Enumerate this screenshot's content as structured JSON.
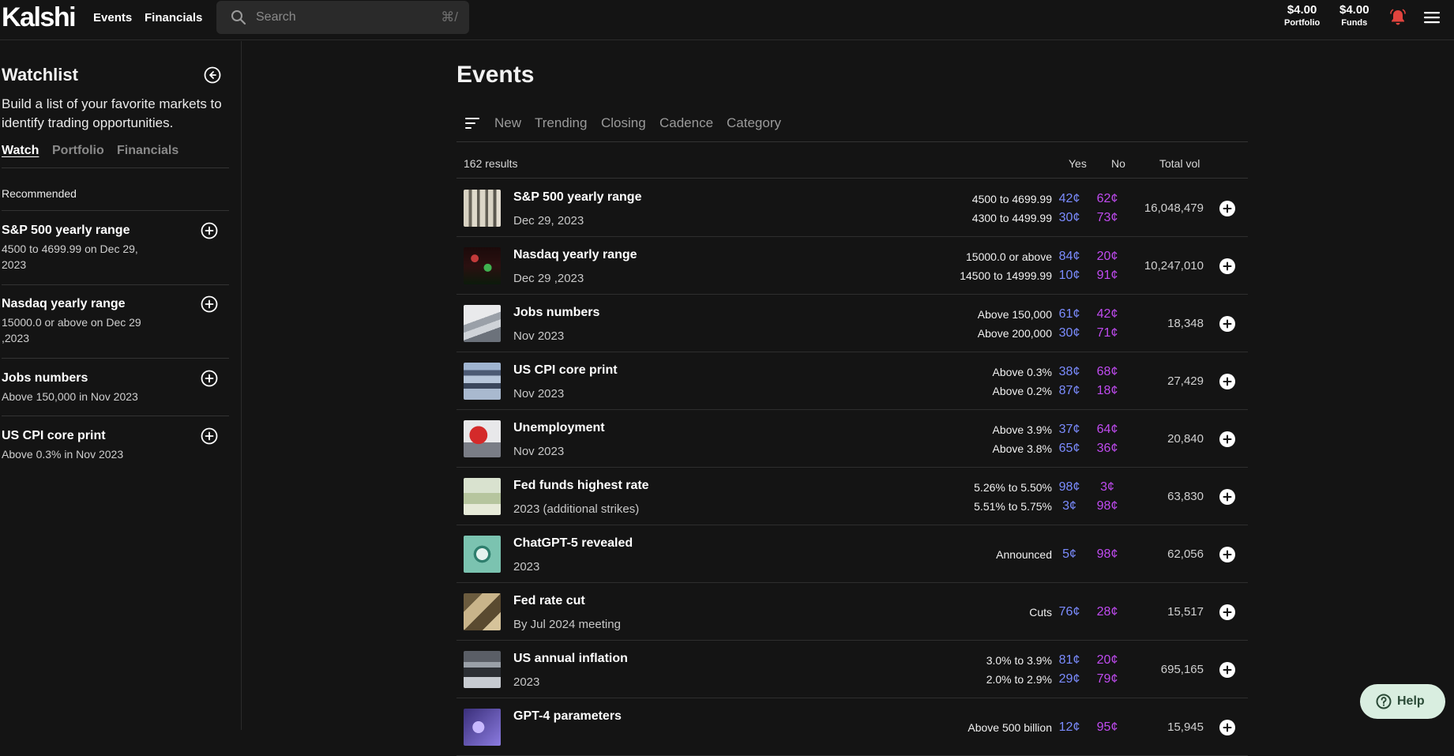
{
  "header": {
    "logo": "Kalshi",
    "nav": [
      {
        "label": "Events"
      },
      {
        "label": "Financials"
      }
    ],
    "search": {
      "placeholder": "Search",
      "shortcut": "⌘/"
    },
    "portfolio": {
      "amount": "$4.00",
      "label": "Portfolio"
    },
    "funds": {
      "amount": "$4.00",
      "label": "Funds"
    },
    "icons": [
      "search-icon",
      "bell-icon",
      "menu-icon"
    ],
    "bell_color": "#e0443e"
  },
  "watchlist": {
    "title": "Watchlist",
    "description": "Build a list of your favorite markets to identify trading opportunities.",
    "tabs": [
      {
        "label": "Watch"
      },
      {
        "label": "Portfolio"
      },
      {
        "label": "Financials"
      }
    ],
    "recommended_label": "Recommended",
    "items": [
      {
        "title": "S&P 500 yearly range",
        "subtitle": "4500 to 4699.99 on Dec 29, 2023"
      },
      {
        "title": "Nasdaq yearly range",
        "subtitle": "15000.0 or above on Dec 29 ,2023"
      },
      {
        "title": "Jobs numbers",
        "subtitle": "Above 150,000 in Nov 2023"
      },
      {
        "title": "US CPI core print",
        "subtitle": "Above 0.3% in Nov 2023"
      }
    ]
  },
  "events": {
    "title": "Events",
    "filters": [
      {
        "label": "New"
      },
      {
        "label": "Trending"
      },
      {
        "label": "Closing"
      },
      {
        "label": "Cadence"
      },
      {
        "label": "Category"
      }
    ],
    "results": "162 results",
    "columns": {
      "yes": "Yes",
      "no": "No",
      "volume": "Total vol"
    },
    "colors": {
      "yes": "#7b8cff",
      "no": "#c04bf0"
    },
    "rows": [
      {
        "name": "S&P 500 yearly range",
        "date": "Dec 29, 2023",
        "volume": "16,048,479",
        "outcomes": [
          {
            "label": "4500 to 4699.99",
            "yes": "42¢",
            "no": "62¢"
          },
          {
            "label": "4300 to 4499.99",
            "yes": "30¢",
            "no": "73¢"
          }
        ]
      },
      {
        "name": "Nasdaq yearly range",
        "date": "Dec 29 ,2023",
        "volume": "10,247,010",
        "outcomes": [
          {
            "label": "15000.0 or above",
            "yes": "84¢",
            "no": "20¢"
          },
          {
            "label": "14500 to 14999.99",
            "yes": "10¢",
            "no": "91¢"
          }
        ]
      },
      {
        "name": "Jobs numbers",
        "date": "Nov 2023",
        "volume": "18,348",
        "outcomes": [
          {
            "label": "Above 150,000",
            "yes": "61¢",
            "no": "42¢"
          },
          {
            "label": "Above 200,000",
            "yes": "30¢",
            "no": "71¢"
          }
        ]
      },
      {
        "name": "US CPI core print",
        "date": "Nov 2023",
        "volume": "27,429",
        "outcomes": [
          {
            "label": "Above 0.3%",
            "yes": "38¢",
            "no": "68¢"
          },
          {
            "label": "Above 0.2%",
            "yes": "87¢",
            "no": "18¢"
          }
        ]
      },
      {
        "name": "Unemployment",
        "date": "Nov 2023",
        "volume": "20,840",
        "outcomes": [
          {
            "label": "Above 3.9%",
            "yes": "37¢",
            "no": "64¢"
          },
          {
            "label": "Above 3.8%",
            "yes": "65¢",
            "no": "36¢"
          }
        ]
      },
      {
        "name": "Fed funds highest rate",
        "date": "2023 (additional strikes)",
        "volume": "63,830",
        "outcomes": [
          {
            "label": "5.26% to 5.50%",
            "yes": "98¢",
            "no": "3¢"
          },
          {
            "label": "5.51% to 5.75%",
            "yes": "3¢",
            "no": "98¢"
          }
        ]
      },
      {
        "name": "ChatGPT-5 revealed",
        "date": "2023",
        "volume": "62,056",
        "outcomes": [
          {
            "label": "Announced",
            "yes": "5¢",
            "no": "98¢"
          }
        ]
      },
      {
        "name": "Fed rate cut",
        "date": "By Jul 2024 meeting",
        "volume": "15,517",
        "outcomes": [
          {
            "label": "Cuts",
            "yes": "76¢",
            "no": "28¢"
          }
        ]
      },
      {
        "name": "US annual inflation",
        "date": "2023",
        "volume": "695,165",
        "outcomes": [
          {
            "label": "3.0% to 3.9%",
            "yes": "81¢",
            "no": "20¢"
          },
          {
            "label": "2.0% to 2.9%",
            "yes": "29¢",
            "no": "79¢"
          }
        ]
      },
      {
        "name": "GPT-4 parameters",
        "date": "",
        "volume": "15,945",
        "outcomes": [
          {
            "label": "Above 500 billion",
            "yes": "12¢",
            "no": "95¢"
          }
        ]
      }
    ]
  },
  "help": {
    "label": "Help"
  }
}
